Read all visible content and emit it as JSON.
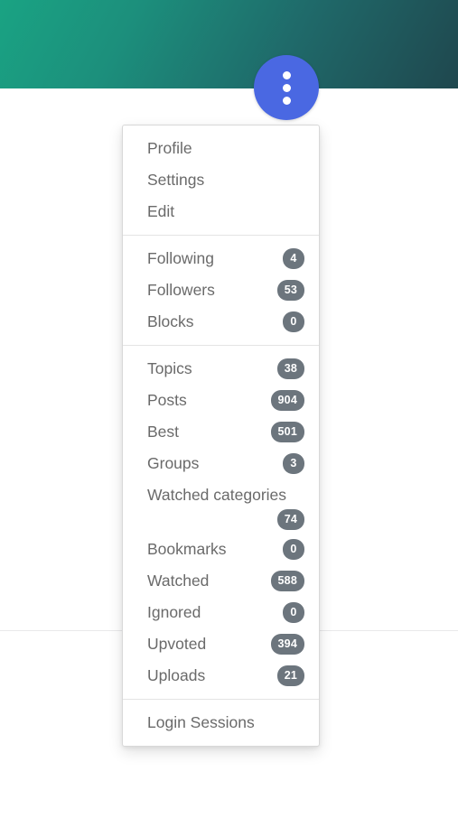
{
  "header": {
    "gradient_from": "#1aa383",
    "gradient_to": "#1f474e"
  },
  "menu_button": {
    "icon": "three-dots-vertical-icon",
    "color": "#4a68e2",
    "dot_color": "#ffffff"
  },
  "dropdown": {
    "badge_color": "#6c757d",
    "label_color": "#6a6a6a",
    "sections": [
      {
        "name": "account",
        "items": [
          {
            "label": "Profile",
            "badge": null
          },
          {
            "label": "Settings",
            "badge": null
          },
          {
            "label": "Edit",
            "badge": null
          }
        ]
      },
      {
        "name": "social",
        "items": [
          {
            "label": "Following",
            "badge": "4"
          },
          {
            "label": "Followers",
            "badge": "53"
          },
          {
            "label": "Blocks",
            "badge": "0"
          }
        ]
      },
      {
        "name": "content",
        "items": [
          {
            "label": "Topics",
            "badge": "38"
          },
          {
            "label": "Posts",
            "badge": "904"
          },
          {
            "label": "Best",
            "badge": "501"
          },
          {
            "label": "Groups",
            "badge": "3"
          },
          {
            "label": "Watched categories",
            "badge": "74",
            "wraps": true
          },
          {
            "label": "Bookmarks",
            "badge": "0"
          },
          {
            "label": "Watched",
            "badge": "588"
          },
          {
            "label": "Ignored",
            "badge": "0"
          },
          {
            "label": "Upvoted",
            "badge": "394"
          },
          {
            "label": "Uploads",
            "badge": "21"
          }
        ]
      },
      {
        "name": "sessions",
        "items": [
          {
            "label": "Login Sessions",
            "badge": null
          }
        ]
      }
    ]
  }
}
